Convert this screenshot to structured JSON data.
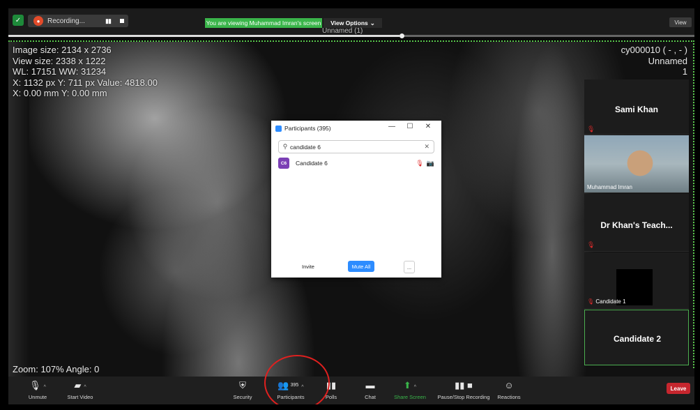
{
  "topbar": {
    "recording_label": "Recording...",
    "pause_icon": "▮▮",
    "viewing_text": "You are viewing Muhammad Imran's screen",
    "view_options_label": "View Options",
    "view_options_caret": "⌄",
    "document_title": "Unnamed (1)",
    "view_button_label": "View",
    "playback_progress": 0.57
  },
  "viewer": {
    "info_lines": [
      "Image size: 2134 x 2736",
      "View size: 2338 x 1222",
      "WL: 17151 WW: 31234",
      "X: 1132 px Y: 711 px Value: 4818.00",
      "X: 0.00 mm Y: 0.00 mm"
    ],
    "top_right_id": "cy000010 ( - , - )",
    "top_right_name": "Unnamed",
    "top_right_index": "1",
    "zoom_text": "Zoom: 107% Angle: 0"
  },
  "participants_panel": {
    "title": "Participants (395)",
    "minimize": "—",
    "maximize": "☐",
    "close": "✕",
    "search_value": "candidate 6",
    "clear_icon": "✕",
    "participants": [
      {
        "initials": "C6",
        "name": "Candidate 6",
        "mic_icon": "🎙",
        "video_icon": "📷"
      }
    ],
    "invite_label": "Invite",
    "mute_all_label": "Mute All",
    "more_label": "..."
  },
  "gallery": {
    "tiles": [
      {
        "name": "Sami Khan"
      },
      {
        "name": "Muhammad Imran"
      },
      {
        "name": "Dr Khan's Teach..."
      },
      {
        "name": "Candidate 1"
      },
      {
        "name": "Candidate 2"
      }
    ]
  },
  "toolbar": {
    "unmute_label": "Unmute",
    "start_video_label": "Start Video",
    "security_label": "Security",
    "participants_label": "Participants",
    "participants_count": "395",
    "polls_label": "Polls",
    "chat_label": "Chat",
    "share_screen_label": "Share Screen",
    "pause_stop_label": "Pause/Stop Recording",
    "reactions_label": "Reactions",
    "leave_label": "Leave",
    "caret": "^"
  }
}
